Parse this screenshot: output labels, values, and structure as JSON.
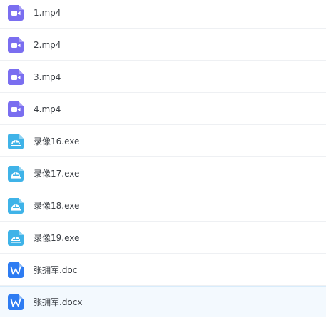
{
  "files": [
    {
      "name": "1.mp4",
      "icon": "video-file-icon",
      "type": "video"
    },
    {
      "name": "2.mp4",
      "icon": "video-file-icon",
      "type": "video"
    },
    {
      "name": "3.mp4",
      "icon": "video-file-icon",
      "type": "video"
    },
    {
      "name": "4.mp4",
      "icon": "video-file-icon",
      "type": "video"
    },
    {
      "name": "录像16.exe",
      "icon": "exe-file-icon",
      "type": "exe"
    },
    {
      "name": "录像17.exe",
      "icon": "exe-file-icon",
      "type": "exe"
    },
    {
      "name": "录像18.exe",
      "icon": "exe-file-icon",
      "type": "exe"
    },
    {
      "name": "录像19.exe",
      "icon": "exe-file-icon",
      "type": "exe"
    },
    {
      "name": "张拥军.doc",
      "icon": "word-file-icon",
      "type": "word"
    },
    {
      "name": "张拥军.docx",
      "icon": "word-file-icon",
      "type": "word",
      "selected": true
    }
  ],
  "colors": {
    "video": "#7a6ef0",
    "exe": "#3fb3e8",
    "word": "#2e7cf2",
    "selected_bg": "#f3f9fe"
  }
}
